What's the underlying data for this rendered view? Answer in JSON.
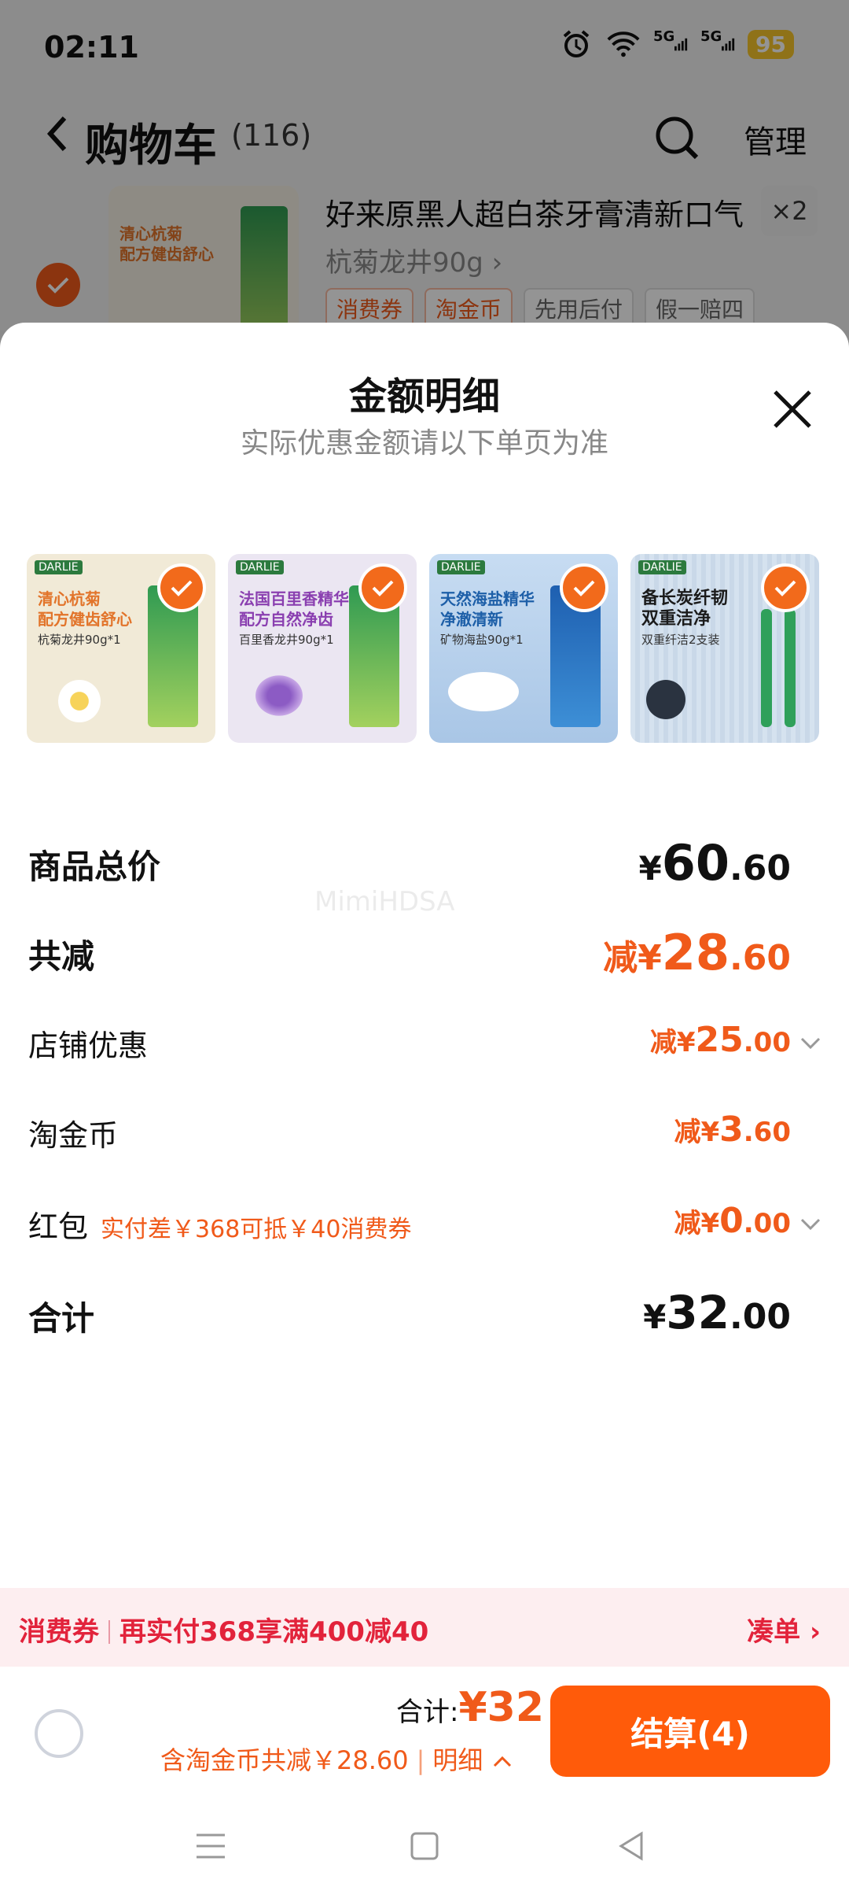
{
  "status_bar": {
    "time": "02:11",
    "signal_1": "5G",
    "signal_2": "5G",
    "battery": "95"
  },
  "cart_header": {
    "title": "购物车",
    "count": "(116)",
    "manage": "管理"
  },
  "background_item": {
    "title": "好来原黑人超白茶牙膏清新口气",
    "spec": "杭菊龙井90g",
    "qty": "×2",
    "tags": [
      "消费券",
      "淘金币",
      "先用后付",
      "假一赔四"
    ]
  },
  "sheet": {
    "title": "金额明细",
    "subtitle": "实际优惠金额请以下单页为准",
    "thumbs": [
      {
        "headline": "清心杭菊\n配方健齿舒心",
        "sub": "杭菊龙井90g*1",
        "bg": "#f1ead7",
        "color": "#e2742a"
      },
      {
        "headline": "法国百里香精华\n配方自然净齿",
        "sub": "百里香龙井90g*1",
        "bg": "#ebe6f2",
        "color": "#8a3fb0"
      },
      {
        "headline": "天然海盐精华\n净澈清新",
        "sub": "矿物海盐90g*1",
        "bg": "#c7dcf2",
        "color": "#1d5fa8"
      },
      {
        "headline": "备长炭纤韧\n双重洁净",
        "sub": "双重纤洁2支装",
        "bg": "#d5e2ef",
        "color": "#1b1b1b"
      }
    ],
    "rows": {
      "subtotal": {
        "label": "商品总价",
        "currency": "¥",
        "int": "60",
        "dec": ".60"
      },
      "discount_total": {
        "label": "共减",
        "prefix": "减¥",
        "int": "28",
        "dec": ".60"
      },
      "shop_discount": {
        "label": "店铺优惠",
        "prefix": "减¥",
        "int": "25",
        "dec": ".00"
      },
      "coins": {
        "label": "淘金币",
        "prefix": "减¥",
        "int": "3",
        "dec": ".60"
      },
      "red_packet": {
        "label": "红包",
        "note": "实付差￥368可抵￥40消费券",
        "prefix": "减¥",
        "int": "0",
        "dec": ".00"
      },
      "total": {
        "label": "合计",
        "currency": "¥",
        "int": "32",
        "dec": ".00"
      }
    }
  },
  "watermark": "MimiHDSA",
  "promo": {
    "tag": "消费券",
    "text": "再实付368享满400减40",
    "action": "凑单"
  },
  "checkout": {
    "total_label": "合计:",
    "total_value": "¥32",
    "detail": "含淘金币共减￥28.60",
    "detail_link": "明细",
    "button": "结算(4)"
  },
  "colors": {
    "accent": "#f05a1a",
    "button": "#ff5b0a",
    "promo_red": "#e2233b"
  }
}
